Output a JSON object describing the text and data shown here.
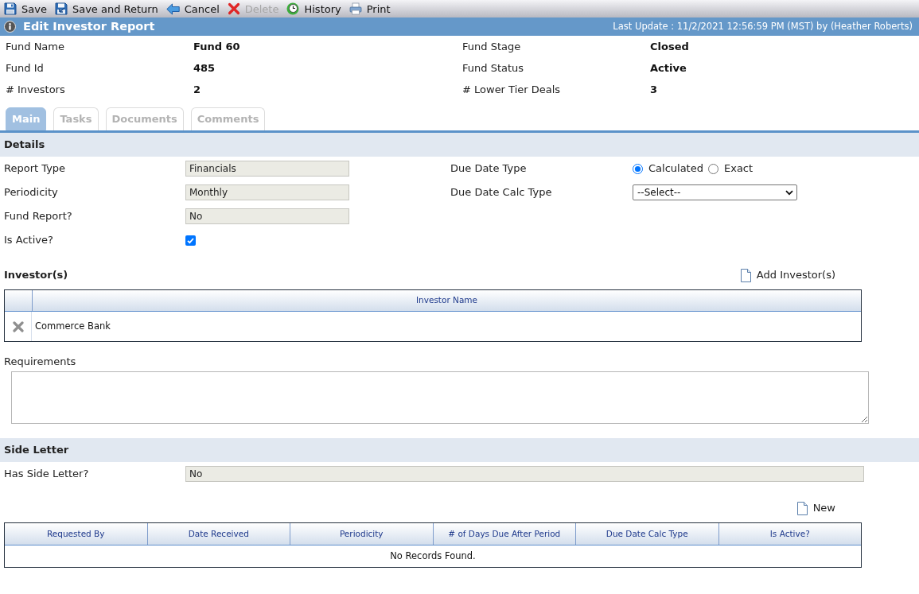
{
  "toolbar": [
    {
      "kind": "save",
      "label": "Save",
      "disabled": false
    },
    {
      "kind": "save_return",
      "label": "Save and Return",
      "disabled": false
    },
    {
      "kind": "cancel",
      "label": "Cancel",
      "disabled": false
    },
    {
      "kind": "delete",
      "label": "Delete",
      "disabled": true
    },
    {
      "kind": "history",
      "label": "History",
      "disabled": false
    },
    {
      "kind": "print",
      "label": "Print",
      "disabled": false
    }
  ],
  "header": {
    "title": "Edit Investor Report",
    "last_update": "Last Update : 11/2/2021 12:56:59 PM (MST) by (Heather Roberts)"
  },
  "summary": [
    {
      "label": "Fund Name",
      "value": "Fund 60"
    },
    {
      "label": "Fund Stage",
      "value": "Closed"
    },
    {
      "label": "Fund Id",
      "value": "485"
    },
    {
      "label": "Fund Status",
      "value": "Active"
    },
    {
      "label": "# Investors",
      "value": "2"
    },
    {
      "label": "# Lower Tier Deals",
      "value": "3"
    }
  ],
  "tabs": [
    {
      "label": "Main",
      "selected": true
    },
    {
      "label": "Tasks",
      "selected": false
    },
    {
      "label": "Documents",
      "selected": false
    },
    {
      "label": "Comments",
      "selected": false
    }
  ],
  "details": {
    "title": "Details",
    "left_fields": [
      {
        "kind": "readonly",
        "label": "Report Type",
        "value": "Financials"
      },
      {
        "kind": "readonly",
        "label": "Periodicity",
        "value": "Monthly"
      },
      {
        "kind": "readonly",
        "label": "Fund Report?",
        "value": "No"
      },
      {
        "kind": "checkbox",
        "label": "Is Active?",
        "checked": true
      }
    ],
    "right_fields": [
      {
        "kind": "radio",
        "label": "Due Date Type",
        "options": [
          {
            "label": "Calculated",
            "selected": true
          },
          {
            "label": "Exact",
            "selected": false
          }
        ]
      },
      {
        "kind": "select",
        "label": "Due Date Calc Type",
        "value": "--Select--"
      }
    ]
  },
  "investors": {
    "title": "Investor(s)",
    "add_label": "Add Investor(s)",
    "columns": [
      "Investor Name"
    ],
    "rows": [
      {
        "name": "Commerce Bank"
      }
    ]
  },
  "requirements": {
    "label": "Requirements"
  },
  "side_letter": {
    "title": "Side Letter",
    "fields": [
      {
        "kind": "readonly",
        "label": "Has Side Letter?",
        "value": "No"
      }
    ],
    "new_label": "New",
    "columns": [
      "Requested By",
      "Date Received",
      "Periodicity",
      "# of Days Due After Period",
      "Due Date Calc Type",
      "Is Active?"
    ],
    "empty_message": "No Records Found."
  }
}
